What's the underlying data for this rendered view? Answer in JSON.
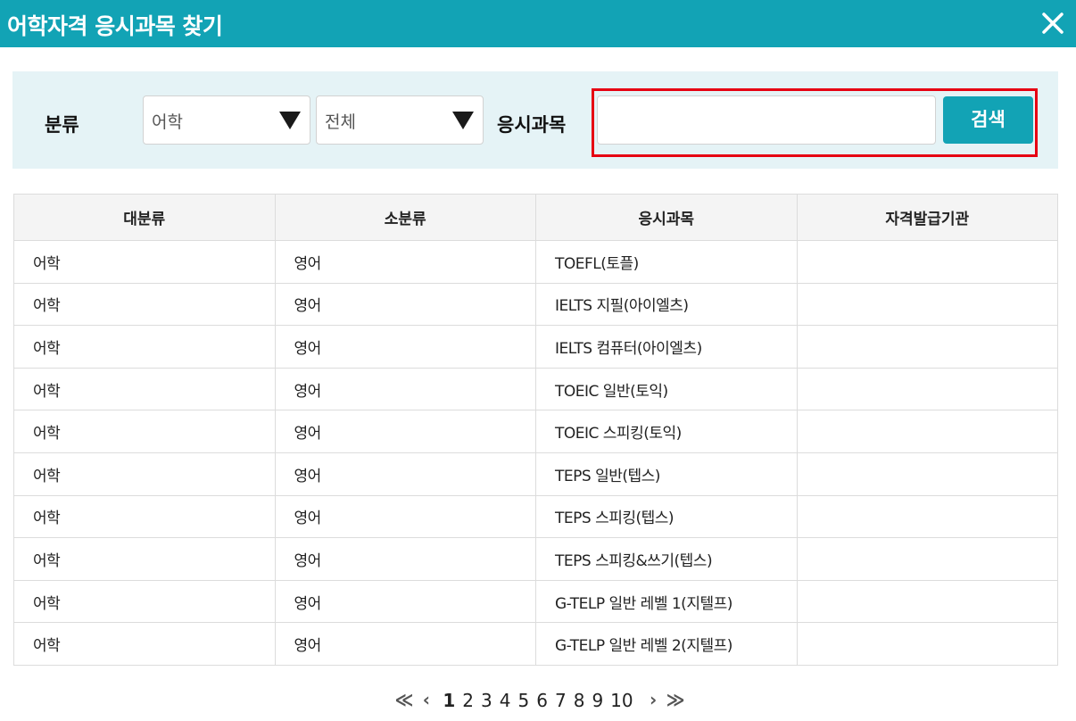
{
  "window": {
    "title": "어학자격 응시과목 찾기",
    "close_icon": "close-icon"
  },
  "search": {
    "category_label": "분류",
    "select1_value": "어학",
    "select2_value": "전체",
    "subject_label": "응시과목",
    "subject_value": "",
    "search_button": "검색",
    "highlight_color": "#e60012"
  },
  "table": {
    "headers": [
      "대분류",
      "소분류",
      "응시과목",
      "자격발급기관"
    ],
    "rows": [
      [
        "어학",
        "영어",
        "TOEFL(토플)",
        ""
      ],
      [
        "어학",
        "영어",
        "IELTS 지필(아이엘츠)",
        ""
      ],
      [
        "어학",
        "영어",
        "IELTS 컴퓨터(아이엘츠)",
        ""
      ],
      [
        "어학",
        "영어",
        "TOEIC 일반(토익)",
        ""
      ],
      [
        "어학",
        "영어",
        "TOEIC 스피킹(토익)",
        ""
      ],
      [
        "어학",
        "영어",
        "TEPS 일반(텝스)",
        ""
      ],
      [
        "어학",
        "영어",
        "TEPS 스피킹(텝스)",
        ""
      ],
      [
        "어학",
        "영어",
        "TEPS 스피킹&쓰기(텝스)",
        ""
      ],
      [
        "어학",
        "영어",
        "G-TELP 일반 레벨 1(지텔프)",
        ""
      ],
      [
        "어학",
        "영어",
        "G-TELP 일반 레벨 2(지텔프)",
        ""
      ]
    ]
  },
  "pagination": {
    "first": "≪",
    "prev": "‹",
    "pages": [
      "1",
      "2",
      "3",
      "4",
      "5",
      "6",
      "7",
      "8",
      "9",
      "10"
    ],
    "current": "1",
    "next": "›",
    "last": "≫"
  },
  "colors": {
    "accent": "#12a3b5",
    "search_bg": "#e5f3f6"
  }
}
